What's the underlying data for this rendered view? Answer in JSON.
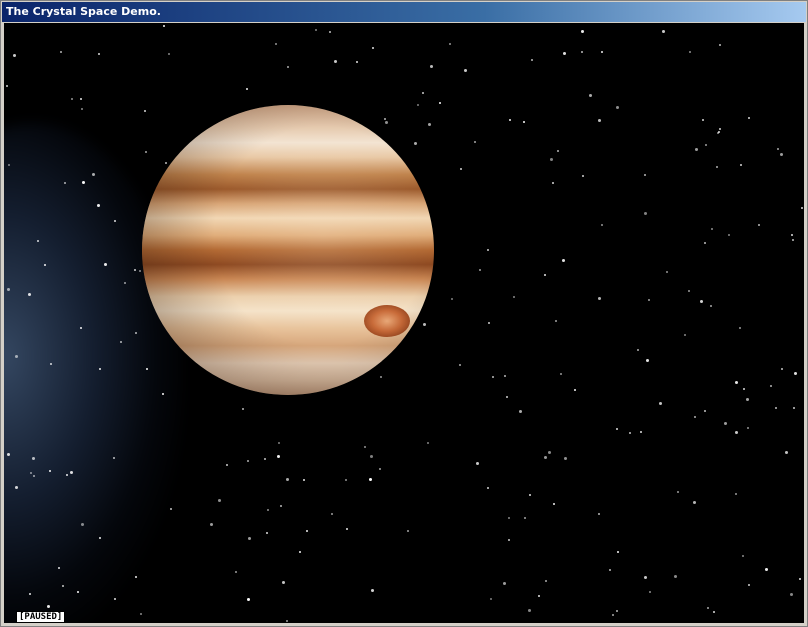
{
  "window": {
    "title": "The Crystal Space Demo."
  },
  "status": {
    "paused_label": "[PAUSED]"
  }
}
